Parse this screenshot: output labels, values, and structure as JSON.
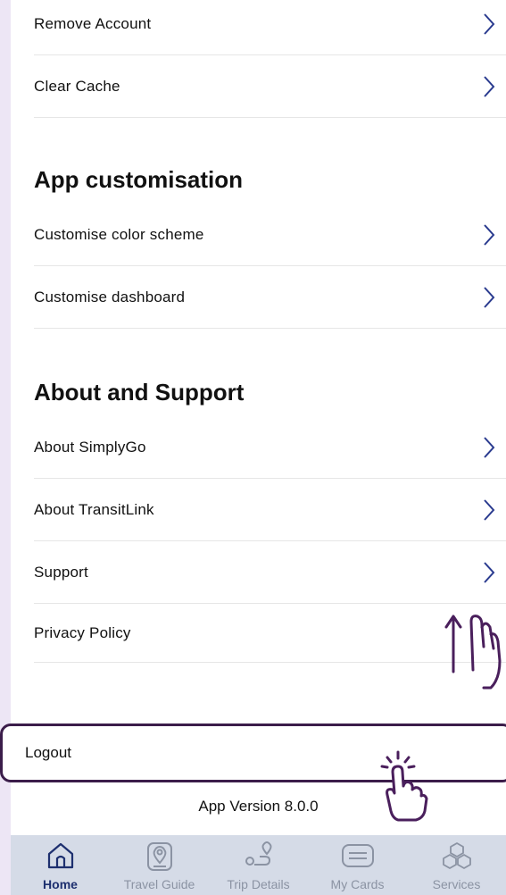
{
  "settings_rows_top": [
    {
      "label": "Remove Account"
    },
    {
      "label": "Clear Cache"
    }
  ],
  "app_customisation": {
    "title": "App customisation",
    "rows": [
      {
        "label": "Customise color scheme"
      },
      {
        "label": "Customise dashboard"
      }
    ]
  },
  "about_support": {
    "title": "About and Support",
    "rows": [
      {
        "label": "About SimplyGo"
      },
      {
        "label": "About TransitLink"
      },
      {
        "label": "Support"
      },
      {
        "label": "Privacy Policy"
      }
    ]
  },
  "logout": {
    "label": "Logout"
  },
  "version": "App Version 8.0.0",
  "tabbar": {
    "tabs": [
      {
        "label": "Home",
        "icon": "home-icon",
        "active": true
      },
      {
        "label": "Travel Guide",
        "icon": "map-pin-icon",
        "active": false
      },
      {
        "label": "Trip Details",
        "icon": "route-icon",
        "active": false
      },
      {
        "label": "My Cards",
        "icon": "card-icon",
        "active": false
      },
      {
        "label": "Services",
        "icon": "services-icon",
        "active": false
      }
    ]
  },
  "colors": {
    "accent": "#1d2f6f",
    "chevron": "#2a3b8f",
    "highlight_border": "#3b1d4a",
    "side_background": "#ede6f5",
    "tabbar_background": "#d5dbe7"
  }
}
